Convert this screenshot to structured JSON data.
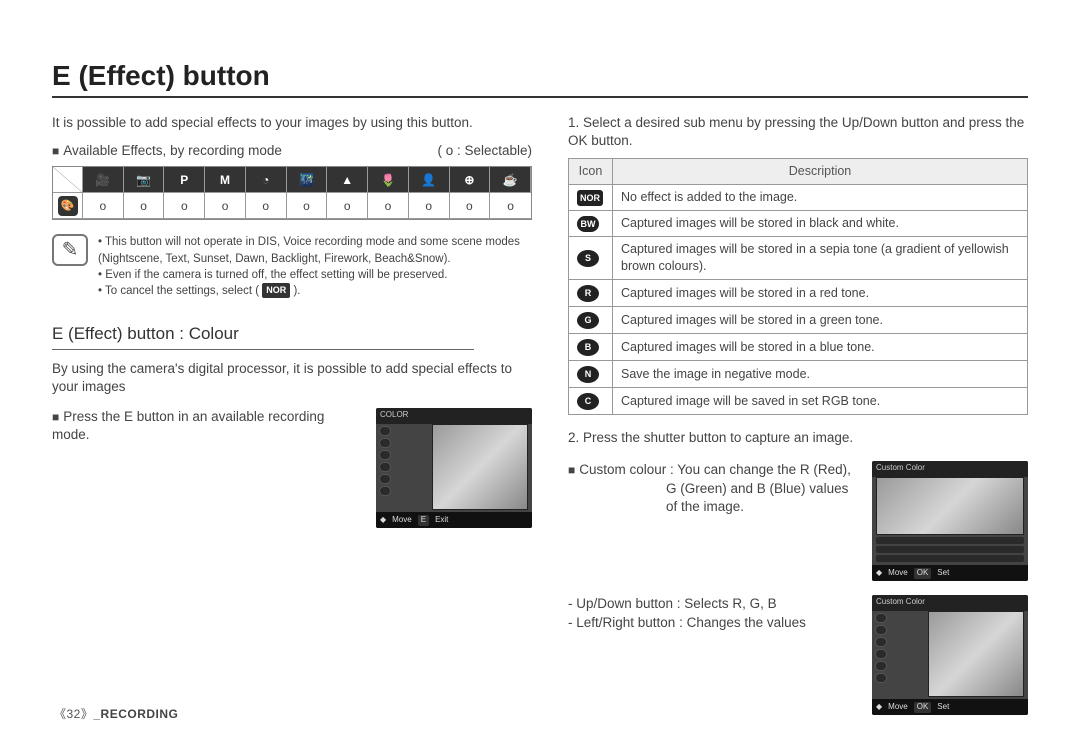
{
  "page": {
    "title": "E (Effect) button",
    "intro": "It is possible to add special effects to your images by using this button.",
    "availableLabel": "Available Effects, by recording mode",
    "selectableLabel": "( o : Selectable)"
  },
  "modeRow": {
    "modes": [
      "🎥",
      "📷",
      "P",
      "M",
      "◔",
      "🌃",
      "▲",
      "🌷",
      "👤",
      "⊕",
      "☕"
    ],
    "marks": [
      "o",
      "o",
      "o",
      "o",
      "o",
      "o",
      "o",
      "o",
      "o",
      "o",
      "o"
    ]
  },
  "notes": {
    "n1": "This button will not operate in DIS, Voice recording mode and some scene modes (Nightscene, Text, Sunset, Dawn, Backlight, Firework, Beach&Snow).",
    "n2": "Even if the camera is turned off, the effect setting will be preserved.",
    "n3a": "To cancel the settings, select ( ",
    "n3b": " ).",
    "norBadge": "NOR"
  },
  "colour": {
    "heading": "E (Effect) button : Colour",
    "intro": "By using the camera's digital processor, it is possible to add special effects to your images",
    "press": "Press the E button in an available recording mode."
  },
  "thumb1": {
    "title": "COLOR",
    "moveLabel": "Move",
    "exitKey": "E",
    "exitLabel": "Exit"
  },
  "right": {
    "step1": "Select a desired sub menu by pressing the Up/Down button and press the OK button.",
    "th_icon": "Icon",
    "th_desc": "Description",
    "rows": {
      "r0": {
        "icon": "NOR",
        "desc": "No effect is added to the image."
      },
      "r1": {
        "icon": "BW",
        "desc": "Captured images will be stored in black and white."
      },
      "r2": {
        "icon": "S",
        "desc": "Captured images will be stored in a sepia tone (a gradient of yellowish brown colours)."
      },
      "r3": {
        "icon": "R",
        "desc": "Captured images will be stored in a red tone."
      },
      "r4": {
        "icon": "G",
        "desc": "Captured images will be stored in a green tone."
      },
      "r5": {
        "icon": "B",
        "desc": "Captured images will be stored in a blue tone."
      },
      "r6": {
        "icon": "N",
        "desc": "Save the image in negative mode."
      },
      "r7": {
        "icon": "C",
        "desc": "Captured image will be saved in set RGB tone."
      }
    },
    "step2": "Press the shutter button to capture an image.",
    "custom1": "Custom colour : You can change the R (Red),",
    "custom2": "G (Green) and B (Blue) values of the image.",
    "updown": "- Up/Down button : Selects R, G, B",
    "leftright": "- Left/Right button : Changes the values"
  },
  "thumbR": {
    "title": "Custom Color",
    "moveLabel": "Move",
    "okKey": "OK",
    "setLabel": "Set"
  },
  "footer": {
    "page": "《32》",
    "section": "_RECORDING"
  }
}
